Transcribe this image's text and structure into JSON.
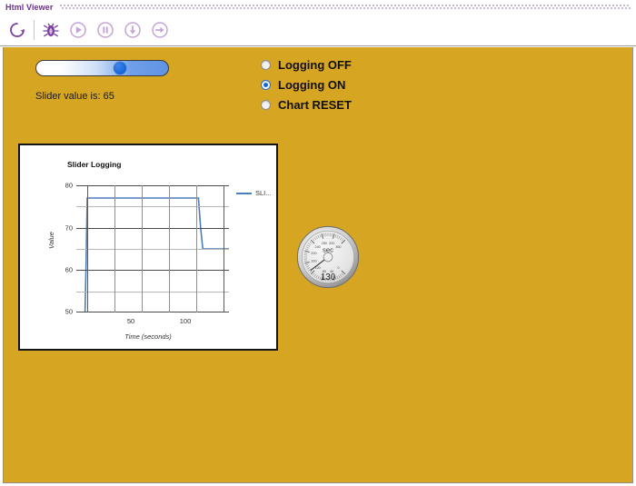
{
  "window": {
    "title": "Html Viewer"
  },
  "toolbar": {
    "buttons": [
      {
        "name": "refresh-icon",
        "label": "Refresh"
      },
      {
        "name": "debug-bug-icon",
        "label": "Debug"
      },
      {
        "name": "run-play-icon",
        "label": "Run"
      },
      {
        "name": "pause-icon",
        "label": "Pause"
      },
      {
        "name": "step-into-icon",
        "label": "Step Into"
      },
      {
        "name": "step-over-icon",
        "label": "Step Over"
      }
    ]
  },
  "controls": {
    "slider": {
      "value": 65,
      "min": 0,
      "max": 100,
      "value_text": "Slider value is: 65"
    },
    "radios": [
      {
        "label": "Logging OFF",
        "checked": false,
        "name": "radio-logging-off"
      },
      {
        "label": "Logging ON",
        "checked": true,
        "name": "radio-logging-on"
      },
      {
        "label": "Chart RESET",
        "checked": false,
        "name": "radio-chart-reset"
      }
    ]
  },
  "gauge": {
    "unit_label": "sec",
    "value_text": "130",
    "value": 130,
    "min": 0,
    "max": 360,
    "ticks": [
      0,
      40,
      80,
      120,
      160,
      200,
      240,
      280,
      320,
      360
    ]
  },
  "colors": {
    "content_background": "#d6a521",
    "accent_purple": "#6b2f8f",
    "series_blue": "#4a7ebb",
    "slider_blue": "#1664d8",
    "radio_blue": "#1667d4"
  },
  "chart_data": {
    "type": "line",
    "title": "Slider Logging",
    "xlabel": "Time (seconds)",
    "ylabel": "Value",
    "xlim": [
      0,
      140
    ],
    "ylim": [
      50,
      80
    ],
    "xticks": [
      50,
      100
    ],
    "yticks_major": [
      50,
      60,
      70,
      80
    ],
    "yticks_minor": [
      55,
      65,
      75
    ],
    "grid": true,
    "legend_position": "right",
    "series": [
      {
        "name": "SLI...",
        "color": "#4a7ebb",
        "x": [
          0,
          8,
          9,
          10,
          112,
          114,
          116,
          140
        ],
        "y": [
          50,
          50,
          62,
          77,
          77,
          70,
          65,
          65
        ]
      }
    ]
  }
}
